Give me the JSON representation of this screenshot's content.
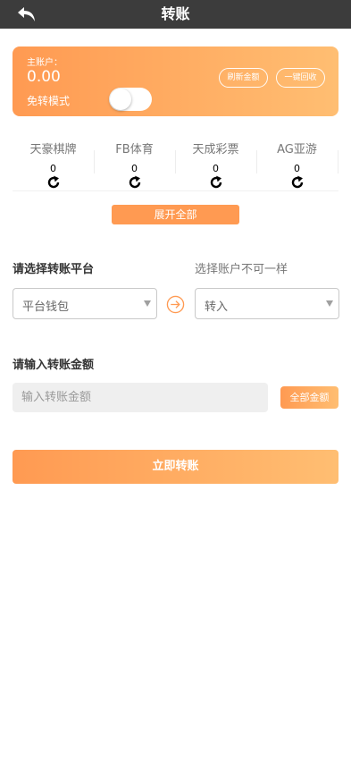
{
  "header": {
    "title": "转账",
    "back_icon": "back-arrow-icon"
  },
  "main_account": {
    "label": "主账户：",
    "amount": "0.00",
    "mode_label": "免转模式",
    "toggle_on": false,
    "refresh_label": "刷新金额",
    "recall_label": "一键回收"
  },
  "platforms": [
    {
      "name": "天豪棋牌",
      "balance": "0",
      "icon": "refresh-icon"
    },
    {
      "name": "FB体育",
      "balance": "0",
      "icon": "refresh-icon"
    },
    {
      "name": "天成彩票",
      "balance": "0",
      "icon": "refresh-icon"
    },
    {
      "name": "AG亚游",
      "balance": "0",
      "icon": "refresh-icon"
    }
  ],
  "expand_label": "展开全部",
  "transfer": {
    "title": "请选择转账平台",
    "hint": "选择账户不可一样",
    "from_value": "平台钱包",
    "to_value": "转入",
    "swap_icon": "arrow-right-circle-icon"
  },
  "amount": {
    "title": "请输入转账金额",
    "placeholder": "输入转账金额",
    "all_label": "全部金额"
  },
  "submit_label": "立即转账",
  "colors": {
    "header_bg": "#3c3c3c",
    "accent_start": "#ff9a52",
    "accent_end": "#ffbe72"
  }
}
